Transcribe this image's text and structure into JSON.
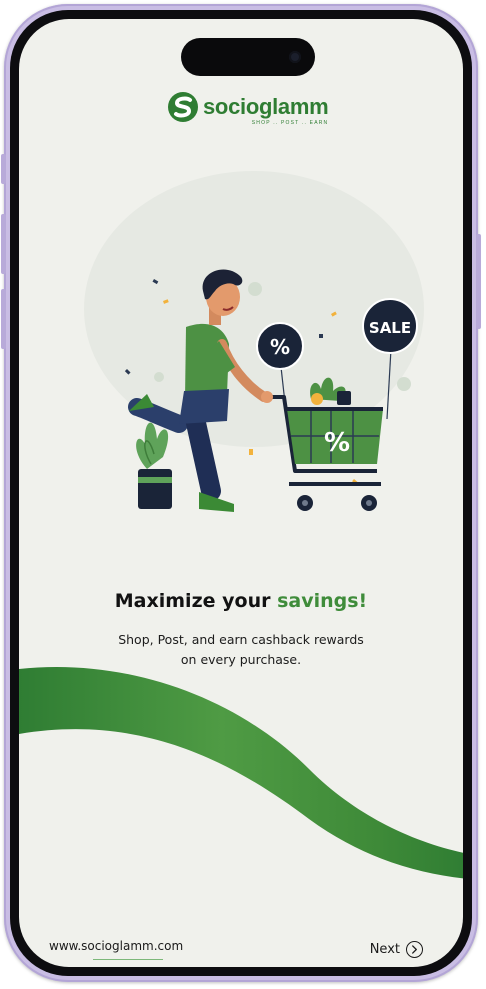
{
  "brand": {
    "name": "socioglamm",
    "tagline": "SHOP .. POST .. EARN",
    "primary_color": "#2f7d33"
  },
  "illustration": {
    "badge_percent": "%",
    "badge_sale": "SALE",
    "cart_percent": "%"
  },
  "onboarding": {
    "headline_prefix": "Maximize your ",
    "headline_accent": "savings!",
    "accent_color": "#3f8c3a",
    "subtext_line1": "Shop, Post, and earn cashback rewards",
    "subtext_line2": "on every purchase."
  },
  "footer": {
    "website": "www.socioglamm.com",
    "next_label": "Next",
    "next_icon": "chevron-right-circle-icon"
  }
}
